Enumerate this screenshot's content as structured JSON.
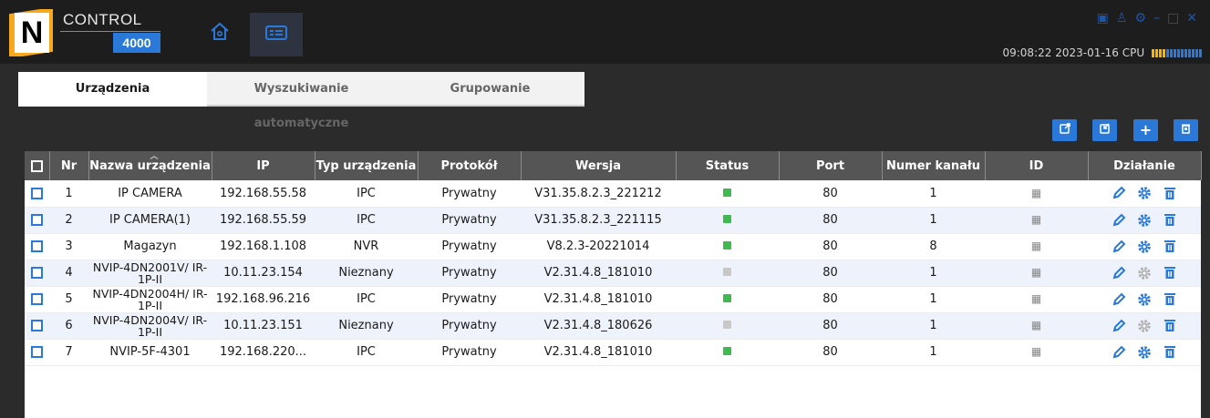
{
  "header": {
    "brand_text": "CONTROL",
    "brand_number": "4000",
    "datetime": "09:08:22 2023-01-16",
    "cpu_label": "CPU",
    "cpu_bars": {
      "used_color": "#f7b500",
      "idle_color": "#2a79d8",
      "used": 4,
      "total": 14
    }
  },
  "tabs": [
    {
      "label": "Urządzenia",
      "active": true
    },
    {
      "label": "Wyszukiwanie automatyczne",
      "active": false
    },
    {
      "label": "Grupowanie",
      "active": false
    }
  ],
  "toolbar": {
    "icons": [
      "export-icon",
      "import-icon",
      "plus-icon",
      "trash-icon"
    ],
    "add_label": "+"
  },
  "table": {
    "columns": [
      "Nr",
      "Nazwa urządzenia",
      "IP",
      "Typ urządzenia",
      "Protokół",
      "Wersja",
      "Status",
      "Port",
      "Numer kanału",
      "ID",
      "Działanie"
    ],
    "rows": [
      {
        "nr": "1",
        "name": "IP CAMERA",
        "ip": "192.168.55.58",
        "type": "IPC",
        "protocol": "Prywatny",
        "version": "V31.35.8.2.3_221212",
        "status": "online",
        "port": "80",
        "channel": "1",
        "settings_enabled": true
      },
      {
        "nr": "2",
        "name": "IP CAMERA(1)",
        "ip": "192.168.55.59",
        "type": "IPC",
        "protocol": "Prywatny",
        "version": "V31.35.8.2.3_221115",
        "status": "online",
        "port": "80",
        "channel": "1",
        "settings_enabled": true
      },
      {
        "nr": "3",
        "name": "Magazyn",
        "ip": "192.168.1.108",
        "type": "NVR",
        "protocol": "Prywatny",
        "version": "V8.2.3-20221014",
        "status": "online",
        "port": "80",
        "channel": "8",
        "settings_enabled": true
      },
      {
        "nr": "4",
        "name": "NVIP-4DN2001V/ IR-1P-II",
        "ip": "10.11.23.154",
        "type": "Nieznany",
        "protocol": "Prywatny",
        "version": "V2.31.4.8_181010",
        "status": "offline",
        "port": "80",
        "channel": "1",
        "settings_enabled": false
      },
      {
        "nr": "5",
        "name": "NVIP-4DN2004H/ IR-1P-II",
        "ip": "192.168.96.216",
        "type": "IPC",
        "protocol": "Prywatny",
        "version": "V2.31.4.8_181010",
        "status": "online",
        "port": "80",
        "channel": "1",
        "settings_enabled": true
      },
      {
        "nr": "6",
        "name": "NVIP-4DN2004V/ IR-1P-II",
        "ip": "10.11.23.151",
        "type": "Nieznany",
        "protocol": "Prywatny",
        "version": "V2.31.4.8_180626",
        "status": "offline",
        "port": "80",
        "channel": "1",
        "settings_enabled": false
      },
      {
        "nr": "7",
        "name": "NVIP-5F-4301",
        "ip": "192.168.220...",
        "type": "IPC",
        "protocol": "Prywatny",
        "version": "V2.31.4.8_181010",
        "status": "online",
        "port": "80",
        "channel": "1",
        "settings_enabled": true
      }
    ]
  },
  "colors": {
    "accent": "#2a79d8",
    "status_online": "#3fb950",
    "status_offline": "#c8c8c8",
    "settings_disabled": "#b0b0b0"
  }
}
